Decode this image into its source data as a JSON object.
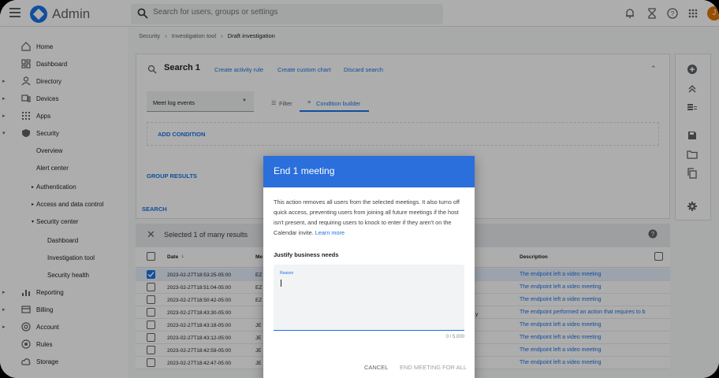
{
  "topbar": {
    "app_title": "Admin",
    "search_placeholder": "Search for users, groups or settings",
    "avatar_letter": "J"
  },
  "breadcrumb": {
    "item1": "Security",
    "sep": "›",
    "item2": "Investigation tool",
    "item3": "Draft investigation"
  },
  "sidebar": {
    "home": "Home",
    "dashboard": "Dashboard",
    "directory": "Directory",
    "devices": "Devices",
    "apps": "Apps",
    "security": "Security",
    "overview": "Overview",
    "alert_center": "Alert center",
    "authentication": "Authentication",
    "access_data_control": "Access and data control",
    "security_center": "Security center",
    "sc_dashboard": "Dashboard",
    "investigation_tool": "Investigation tool",
    "security_health": "Security health",
    "reporting": "Reporting",
    "billing": "Billing",
    "account": "Account",
    "rules": "Rules",
    "storage": "Storage"
  },
  "search_card": {
    "title": "Search 1",
    "create_activity_rule": "Create activity rule",
    "create_custom_chart": "Create custom chart",
    "discard_search": "Discard search",
    "data_source": "Meet log events",
    "filter_tab": "Filter",
    "condition_builder_tab": "Condition builder",
    "add_condition": "ADD CONDITION"
  },
  "group_results": "GROUP RESULTS",
  "search_button": "SEARCH",
  "results": {
    "selection_text": "Selected 1 of many results",
    "col_date": "Date",
    "col_me": "Me",
    "col_description": "Description",
    "rows": [
      {
        "date": "2023-02-27T18:53:25-05:00",
        "me": "EZ",
        "desc": "The endpoint left a video meeting",
        "selected": true
      },
      {
        "date": "2023-02-27T18:51:04-05:00",
        "me": "EZ",
        "desc": "The endpoint left a video meeting",
        "selected": false
      },
      {
        "date": "2023-02-27T18:50:42-05:00",
        "me": "EZ",
        "desc": "The endpoint left a video meeting",
        "selected": false
      },
      {
        "date": "2023-02-27T18:43:30-05:00",
        "me": "",
        "desc": "The endpoint performed an action that requires to b",
        "selected": false
      },
      {
        "date": "2023-02-27T18:43:18-05:00",
        "me": "JE",
        "desc": "The endpoint left a video meeting",
        "selected": false
      },
      {
        "date": "2023-02-27T18:43:12-05:00",
        "me": "JE",
        "desc": "The endpoint left a video meeting",
        "selected": false
      },
      {
        "date": "2023-02-27T18:42:59-05:00",
        "me": "JE",
        "desc": "The endpoint left a video meeting",
        "selected": false
      },
      {
        "date": "2023-02-27T18:42:47-05:00",
        "me": "JE",
        "desc": "The endpoint left a video meeting",
        "selected": false
      }
    ],
    "partial_fragment": "y"
  },
  "dialog": {
    "title": "End 1 meeting",
    "body": "This action removes all users from the selected meetings. It also turns off quick access, preventing users from joining all future meetings if the host isn't present, and requiring users to knock to enter if they aren't on the Calendar invite.",
    "learn_more": "Learn more",
    "subhead": "Justify business needs",
    "reason_label": "Reason",
    "counter": "0 / 5,000",
    "cancel": "CANCEL",
    "end_all": "END MEETING FOR ALL"
  },
  "colors": {
    "accent": "#1a73e8",
    "dialog_header": "#2a6fdb",
    "avatar": "#e37400"
  }
}
